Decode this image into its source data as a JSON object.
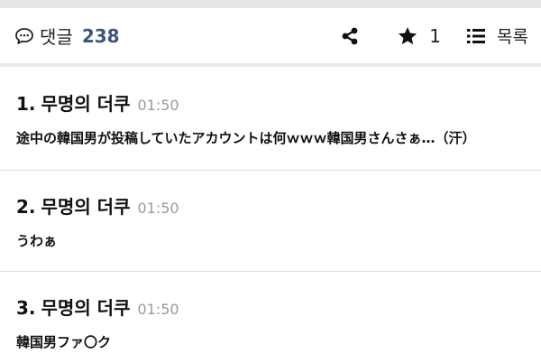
{
  "header": {
    "icon": "speech-bubble-icon",
    "title": "댓글",
    "count": "238",
    "share_icon": "share-icon",
    "star_icon": "star-icon",
    "star_count": "1",
    "list_icon": "list-icon",
    "list_label": "목록",
    "accent_color": "#3b5677"
  },
  "comments": [
    {
      "number": "1.",
      "author": "무명의 더쿠",
      "time": "01:50",
      "body": "途中の韓国男が投稿していたアカウントは何ｗｗｗ韓国男さんさぁ…（汗）"
    },
    {
      "number": "2.",
      "author": "무명의 더쿠",
      "time": "01:50",
      "body": "うわぁ"
    },
    {
      "number": "3.",
      "author": "무명의 더쿠",
      "time": "01:50",
      "body": "韓国男ファ〇ク"
    }
  ]
}
